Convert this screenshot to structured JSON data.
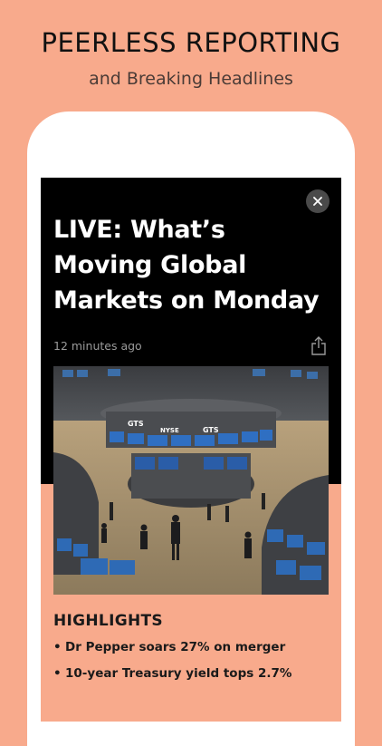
{
  "promo": {
    "title": "PEERLESS REPORTING",
    "subtitle": "and Breaking Headlines"
  },
  "article": {
    "headline": "LIVE: What’s Moving Global Markets on Monday",
    "timestamp": "12 minutes ago",
    "close_icon": "close-icon",
    "share_icon": "share-icon",
    "photo_signs": [
      "GTS",
      "NYSE",
      "GTS"
    ],
    "highlights_title": "HIGHLIGHTS",
    "highlights": [
      "Dr Pepper soars 27% on merger",
      "10-year Treasury yield tops 2.7%"
    ]
  },
  "colors": {
    "background": "#f8aa8c",
    "article_header": "#000000",
    "card": "#ffffff"
  }
}
